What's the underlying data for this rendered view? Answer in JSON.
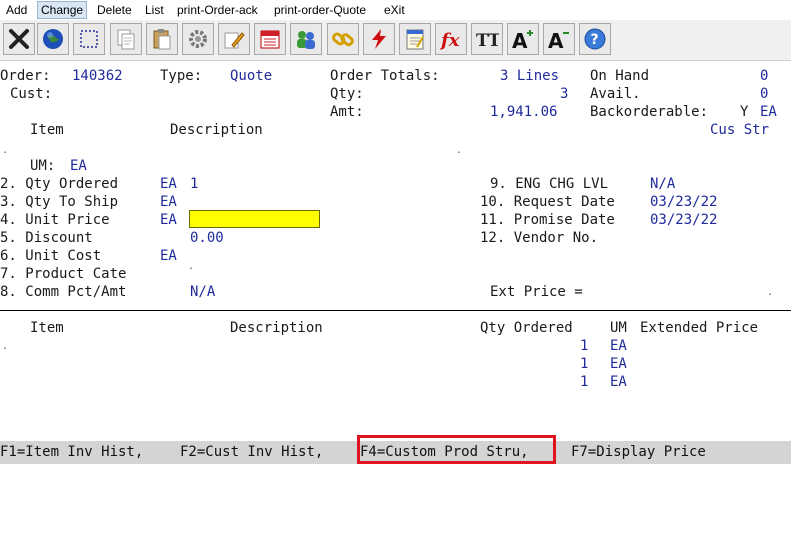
{
  "menu": [
    {
      "label": "Add"
    },
    {
      "label": "Change",
      "active": true
    },
    {
      "label": "Delete"
    },
    {
      "label": "List"
    },
    {
      "label": "print-Order-ack"
    },
    {
      "label": "print-order-Quote"
    },
    {
      "label": "eXit"
    }
  ],
  "toolbar": {
    "icons": [
      "close-icon",
      "globe-icon",
      "select-icon",
      "copy-icon",
      "paste-icon",
      "settings-icon",
      "edit-icon",
      "calendar-icon",
      "users-icon",
      "link-icon",
      "lightning-icon",
      "notepad-icon",
      "function-icon",
      "font-size-icon",
      "font-increase-icon",
      "font-decrease-icon",
      "help-icon"
    ],
    "fx_label": "fx",
    "tt_label": "TT",
    "a_label": "A",
    "help_label": "?"
  },
  "header": {
    "order_label": "Order:",
    "order_value": "140362",
    "type_label": "Type:",
    "type_value": "Quote",
    "cust_label": "Cust:",
    "order_totals_label": "Order Totals:",
    "lines_value": "3 Lines",
    "qty_label": "Qty:",
    "qty_value": "3",
    "amt_label": "Amt:",
    "amt_value": "1,941.06",
    "on_hand_label": "On Hand",
    "on_hand_value": "0",
    "avail_label": "Avail.",
    "avail_value": "0",
    "backorderable_label": "Backorderable:",
    "backorderable_value": "Y",
    "backorderable_um": "EA"
  },
  "columns": {
    "item": "Item",
    "description": "Description",
    "cus_str": "Cus Str"
  },
  "detail": {
    "um_label": "UM:",
    "um_value": "EA",
    "fields_left": [
      {
        "label": "2. Qty Ordered",
        "um": "EA",
        "value": "1"
      },
      {
        "label": "3. Qty To Ship",
        "um": "EA",
        "value": ""
      },
      {
        "label": "4. Unit Price",
        "um": "EA",
        "value": ""
      },
      {
        "label": "5. Discount",
        "um": "",
        "value": "0.00"
      },
      {
        "label": "6. Unit Cost",
        "um": "EA",
        "value": ""
      },
      {
        "label": "7. Product Cate",
        "um": "",
        "value": ""
      },
      {
        "label": "8. Comm Pct/Amt",
        "um": "",
        "value": "N/A"
      }
    ],
    "fields_right": [
      {
        "label": "9. ENG CHG LVL",
        "value": "N/A"
      },
      {
        "label": "10. Request Date",
        "value": "03/23/22"
      },
      {
        "label": "11. Promise Date",
        "value": "03/23/22"
      },
      {
        "label": "12. Vendor No.",
        "value": ""
      }
    ],
    "ext_price_label": "Ext Price ="
  },
  "lines_table": {
    "headers": [
      "Item",
      "Description",
      "Qty Ordered",
      "UM",
      "Extended Price"
    ],
    "rows": [
      {
        "qty": "1",
        "um": "EA"
      },
      {
        "qty": "1",
        "um": "EA"
      },
      {
        "qty": "1",
        "um": "EA"
      }
    ]
  },
  "status": {
    "f1": "F1=Item Inv Hist,",
    "f2": "F2=Cust Inv Hist,",
    "f4": "F4=Custom Prod Stru,",
    "f7": "F7=Display Price"
  },
  "colors": {
    "accent_text": "#1f2a9c",
    "highlight": "#ffff00",
    "callout": "#e0141e"
  }
}
